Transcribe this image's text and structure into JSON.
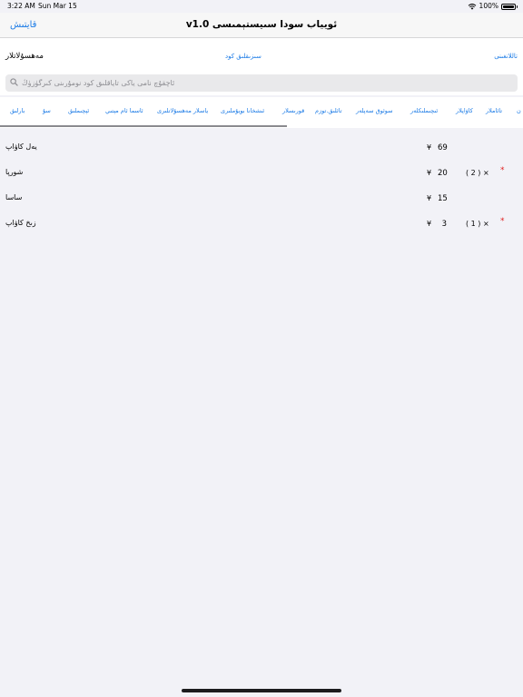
{
  "status": {
    "time": "3:22 AM",
    "date": "Sun Mar 15",
    "battery": "100%",
    "battery_level": 1.0
  },
  "nav": {
    "title": "ئويياب سودا سىيستېمىسى v1.0",
    "back_label": "قايتىش"
  },
  "filters": {
    "left_label": "مەھسۇلاتلار",
    "mid_label": "سىزىقلىق كود",
    "right_label": "تاللانغىنى"
  },
  "search": {
    "placeholder": "ئاچقۇچ نامى ياكى تاياقلىق كود نومۇرىنى كىرگۈزۈڭ",
    "value": ""
  },
  "tabs": [
    "بارلىق",
    "سۇ",
    "ئېچىملىق",
    "ئاسما ئام مېتىي",
    "ياسلار مەھسۇلاتلىرى",
    "ئىشخانا بويۇملىرى",
    "قورىسلار",
    "تائلىق.توزم",
    "سوئوق سەپلەر",
    "ئىچىملىكلەر",
    "كاۋاپلار",
    "تائاملار",
    "ن"
  ],
  "items": [
    {
      "name": "يەل كاۋاپ",
      "currency": "¥",
      "price": "69",
      "qty": "",
      "starred": false
    },
    {
      "name": "شورپا",
      "currency": "¥",
      "price": "20",
      "qty": "( 2 ) ×",
      "starred": true
    },
    {
      "name": "ساسا",
      "currency": "¥",
      "price": "15",
      "qty": "",
      "starred": false
    },
    {
      "name": "زىخ كاۋاپ",
      "currency": "¥",
      "price": "3",
      "qty": "( 1 ) ×",
      "starred": true
    }
  ],
  "star_symbol": "*",
  "colors": {
    "accent": "#1a7ae6",
    "star": "#e02020",
    "background": "#f2f2f7"
  }
}
